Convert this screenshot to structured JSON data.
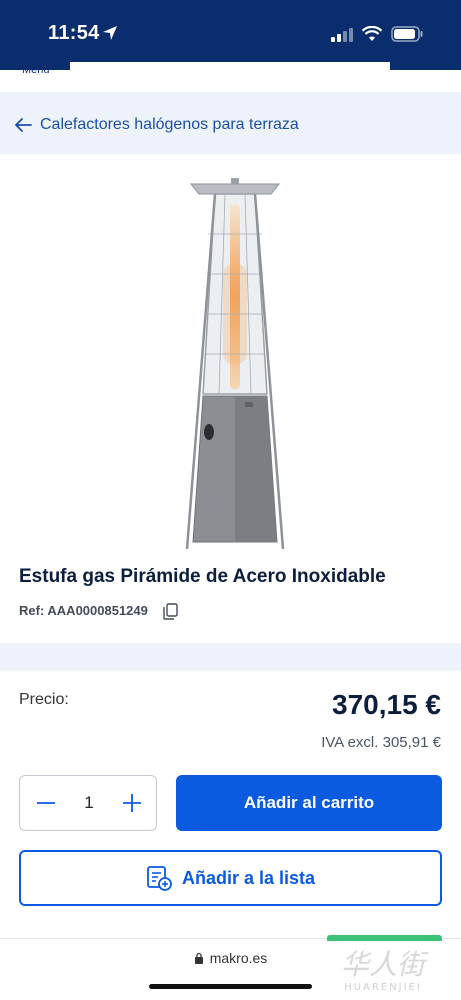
{
  "status_bar": {
    "time": "11:54"
  },
  "header": {
    "menu_label": "Menu"
  },
  "breadcrumb": {
    "label": "Calefactores halógenos para terraza"
  },
  "product": {
    "title": "Estufa gas Pirámide de Acero Inoxidable",
    "ref_label": "Ref: AAA0000851249"
  },
  "pricing": {
    "label": "Precio:",
    "price": "370,15 €",
    "vat_excl": "IVA excl. 305,91 €"
  },
  "quantity": {
    "value": "1"
  },
  "actions": {
    "add_to_cart": "Añadir al carrito",
    "add_to_list": "Añadir a la lista"
  },
  "browser": {
    "url": "makro.es"
  },
  "watermark": {
    "cn": "华人街",
    "en": "HUARENJIEI"
  },
  "colors": {
    "navy": "#0a2d6e",
    "primary": "#0a5be0",
    "band": "#eef3fb"
  }
}
